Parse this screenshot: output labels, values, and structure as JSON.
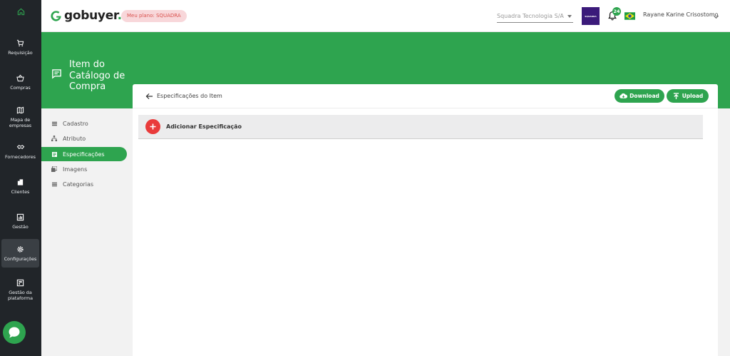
{
  "rail": {
    "items": [
      {
        "label": "Requisição",
        "icon": "cart-icon"
      },
      {
        "label": "Compras",
        "icon": "basket-icon"
      },
      {
        "label": "Mapa de empresas",
        "icon": "map-icon"
      },
      {
        "label": "Fornecedores",
        "icon": "handshake-icon"
      },
      {
        "label": "Clientes",
        "icon": "building-icon"
      },
      {
        "label": "Gestão",
        "icon": "chart-icon"
      },
      {
        "label": "Configurações",
        "icon": "gear-icon",
        "active": true
      },
      {
        "label": "Gestão da plataforma",
        "icon": "dashboard-icon"
      }
    ]
  },
  "header": {
    "brand": "gobuyer",
    "brand_dot": ".",
    "plan_badge": "Meu plano: SQUADRA",
    "company": "Squadra Tecnologia S/A",
    "notifications_count": "24",
    "user_name": "Rayane Karine Crisostomo"
  },
  "hero": {
    "title": "Item do Catálogo de Compra"
  },
  "subnav": {
    "items": [
      {
        "label": "Cadastro"
      },
      {
        "label": "Atributo"
      },
      {
        "label": "Especificações",
        "active": true
      },
      {
        "label": "Imagens"
      },
      {
        "label": "Categorias"
      }
    ]
  },
  "card": {
    "title": "Especificações do Item",
    "download_label": "Download",
    "upload_label": "Upload",
    "add_spec_label": "Adicionar Especificação"
  },
  "colors": {
    "brand_green": "#2ea44f",
    "rail_bg": "#212529",
    "add_red": "#e93b3b",
    "plan_badge_bg": "#f8d7da"
  }
}
